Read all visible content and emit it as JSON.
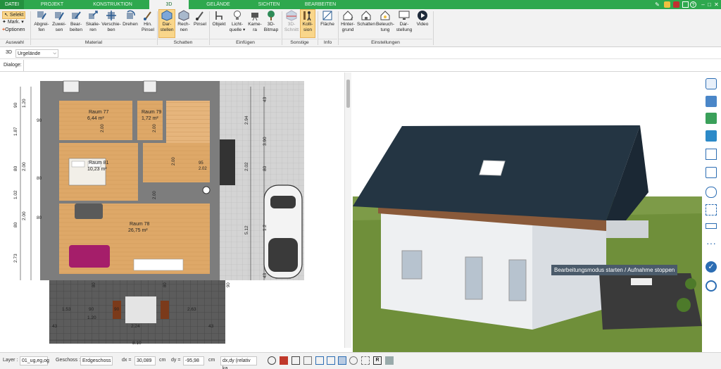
{
  "menu": {
    "tabs": [
      "DATEI",
      "PROJEKT",
      "KONSTRUKTION",
      "3D",
      "GELÄNDE",
      "SICHTEN",
      "BEARBEITEN"
    ],
    "active": "3D"
  },
  "ribbon": {
    "select_label": "Selekt",
    "mark_label": "Mark.",
    "options_label": "Optionen",
    "buttons": {
      "abgreifen": [
        "Abgrei-",
        "fen"
      ],
      "zuweisen": [
        "Zuwei-",
        "sen"
      ],
      "bearbeiten": [
        "Bear-",
        "beiten"
      ],
      "skalieren": [
        "Skalie-",
        "ren"
      ],
      "verschieben": [
        "Verschie-",
        "ben"
      ],
      "drehen": [
        "Drehen",
        ""
      ],
      "hinpinsel": [
        "Hin.",
        "Pinsel"
      ],
      "darstellen": [
        "Dar-",
        "stellen"
      ],
      "rechnen": [
        "Rech-",
        "nen"
      ],
      "pinsel": [
        "Pinsel",
        ""
      ],
      "objekt": [
        "Objekt",
        ""
      ],
      "lichtquelle": [
        "Licht-",
        "quelle"
      ],
      "kamera": [
        "Kame-",
        "ra"
      ],
      "bitmap": [
        "3D-",
        "Bitmap"
      ],
      "schnitt": [
        "3D-",
        "Schnitt"
      ],
      "kollision": [
        "Kolli-",
        "sion"
      ],
      "flaeche": [
        "Fläche",
        ""
      ],
      "hintergrund": [
        "Hinter-",
        "grund"
      ],
      "schatten": [
        "Schatten",
        ""
      ],
      "beleuchtung": [
        "Beleuch-",
        "tung"
      ],
      "darstellung": [
        "Dar-",
        "stellung"
      ],
      "video": [
        "Video",
        ""
      ]
    },
    "groups": [
      "Auswahl",
      "Material",
      "Schatten",
      "Einfügen",
      "Sonstige",
      "Info",
      "Einstellungen"
    ]
  },
  "toolbar": {
    "mode": "3D",
    "terrain_value": "Urgelände",
    "dialog_label": "Dialoge:"
  },
  "plan": {
    "rooms": [
      {
        "name": "Raum 77",
        "area": "6,44 m²"
      },
      {
        "name": "Raum 79",
        "area": "1,72 m²"
      },
      {
        "name": "Raum 81",
        "area": "10,23 m²"
      },
      {
        "name": "Raum 78",
        "area": "26,75 m²"
      }
    ],
    "left_dims": [
      "1.20",
      "90",
      "1.87",
      "80",
      "2.00",
      "1.02",
      "80",
      "2.00",
      "2.73",
      "90",
      "80",
      "80"
    ],
    "right_dims": [
      "43",
      "2.94",
      "3.90",
      "2.02",
      "80",
      "5.12",
      "1.2",
      "43"
    ],
    "bottom_dims": [
      "1.53",
      "90",
      "1.20",
      "90",
      "2.63",
      "2.24",
      "43",
      "43",
      "8.10"
    ],
    "door_dims": [
      "2.00",
      "2.00",
      "2.00",
      "2.00",
      "95",
      "2.02",
      "80",
      "80",
      "90"
    ]
  },
  "tooltip": "Bearbeitungsmodus starten / Aufnahme stoppen",
  "status": {
    "layer_label": "Layer :",
    "layer_value": "01_ug,eg,og",
    "floor_label": "Geschoss :",
    "floor_value": "Erdgeschoss",
    "dx_label": "dx =",
    "dx_value": "30,089",
    "dx_unit": "cm",
    "dy_label": "dy =",
    "dy_value": "-95,98",
    "dy_unit": "cm",
    "mode_value": "dx,dy (relativ ka"
  },
  "colors": {
    "accent": "#2ea84e",
    "roof": "#243543",
    "wall": "#e9ecef",
    "grass": "#6f8f3a",
    "floor": "#d9a35c"
  }
}
